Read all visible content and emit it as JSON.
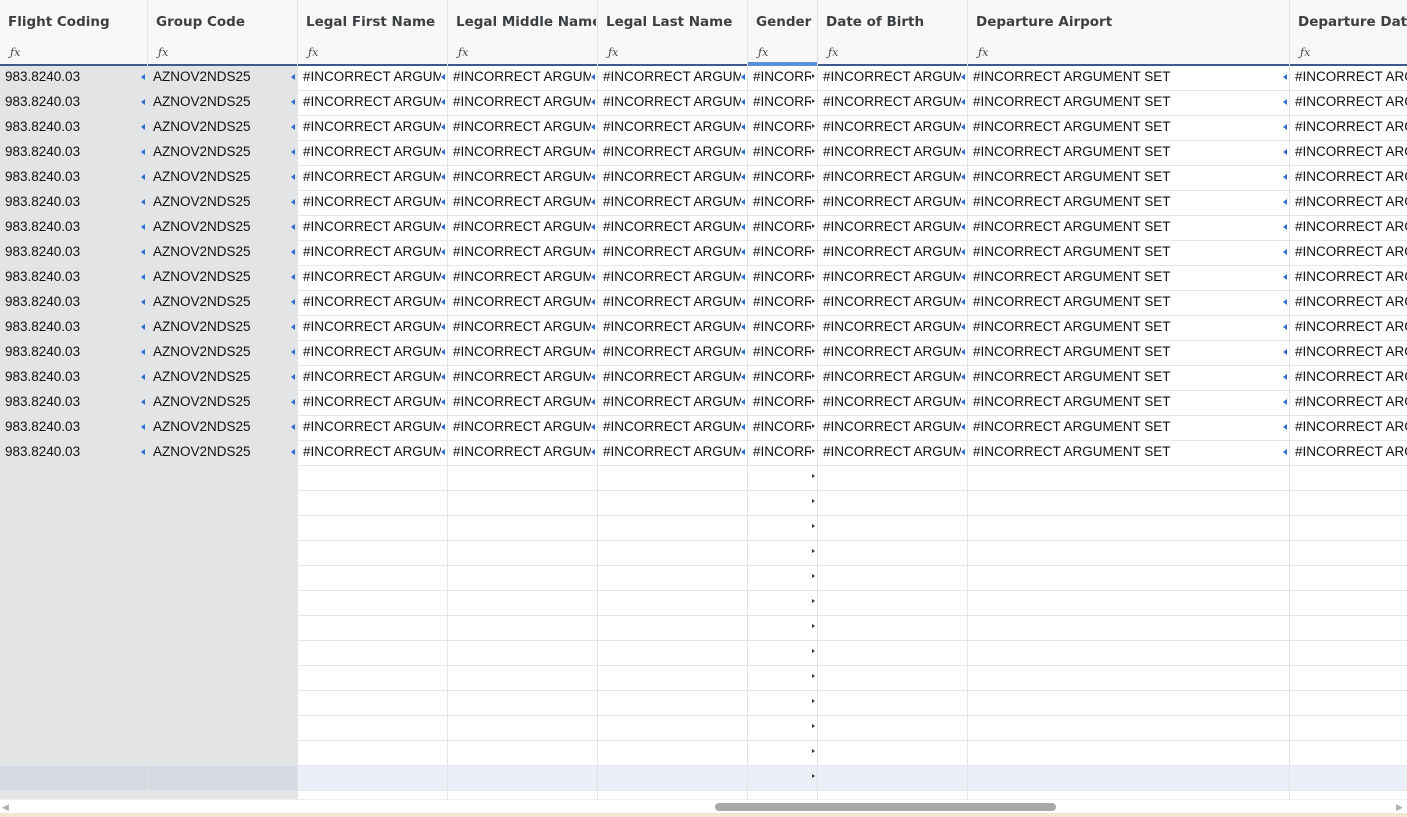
{
  "columns": [
    {
      "key": "flight_coding",
      "label": "Flight Coding",
      "frozen": true
    },
    {
      "key": "group_code",
      "label": "Group Code",
      "frozen": true
    },
    {
      "key": "legal_first_name",
      "label": "Legal First Name"
    },
    {
      "key": "legal_middle_name",
      "label": "Legal Middle Name"
    },
    {
      "key": "legal_last_name",
      "label": "Legal Last Name"
    },
    {
      "key": "gender",
      "label": "Gender",
      "selected": true
    },
    {
      "key": "date_of_birth",
      "label": "Date of Birth"
    },
    {
      "key": "departure_airport",
      "label": "Departure Airport"
    },
    {
      "key": "departure_date",
      "label": "Departure Date"
    }
  ],
  "formula_icon": "fx-icon",
  "cell_values": {
    "flight_coding": "983.8240.03",
    "group_code": "AZNOV2NDS25",
    "legal_first_name": "#INCORRECT ARGUM",
    "legal_middle_name": "#INCORRECT ARGUM",
    "legal_last_name": "#INCORRECT ARGUM",
    "gender": "#INCORR",
    "date_of_birth": "#INCORRECT ARGUM",
    "departure_airport": "#INCORRECT ARGUMENT SET",
    "departure_date": "#INCORRECT ARG"
  },
  "filled_row_count": 16,
  "empty_row_count": 13,
  "selected_empty_row": 12,
  "colors": {
    "header_underline": "#3d5a8c",
    "selection": "#5b8fd6",
    "frozen_bg": "#e3e4e6",
    "marker_blue": "#2f6bd1"
  }
}
